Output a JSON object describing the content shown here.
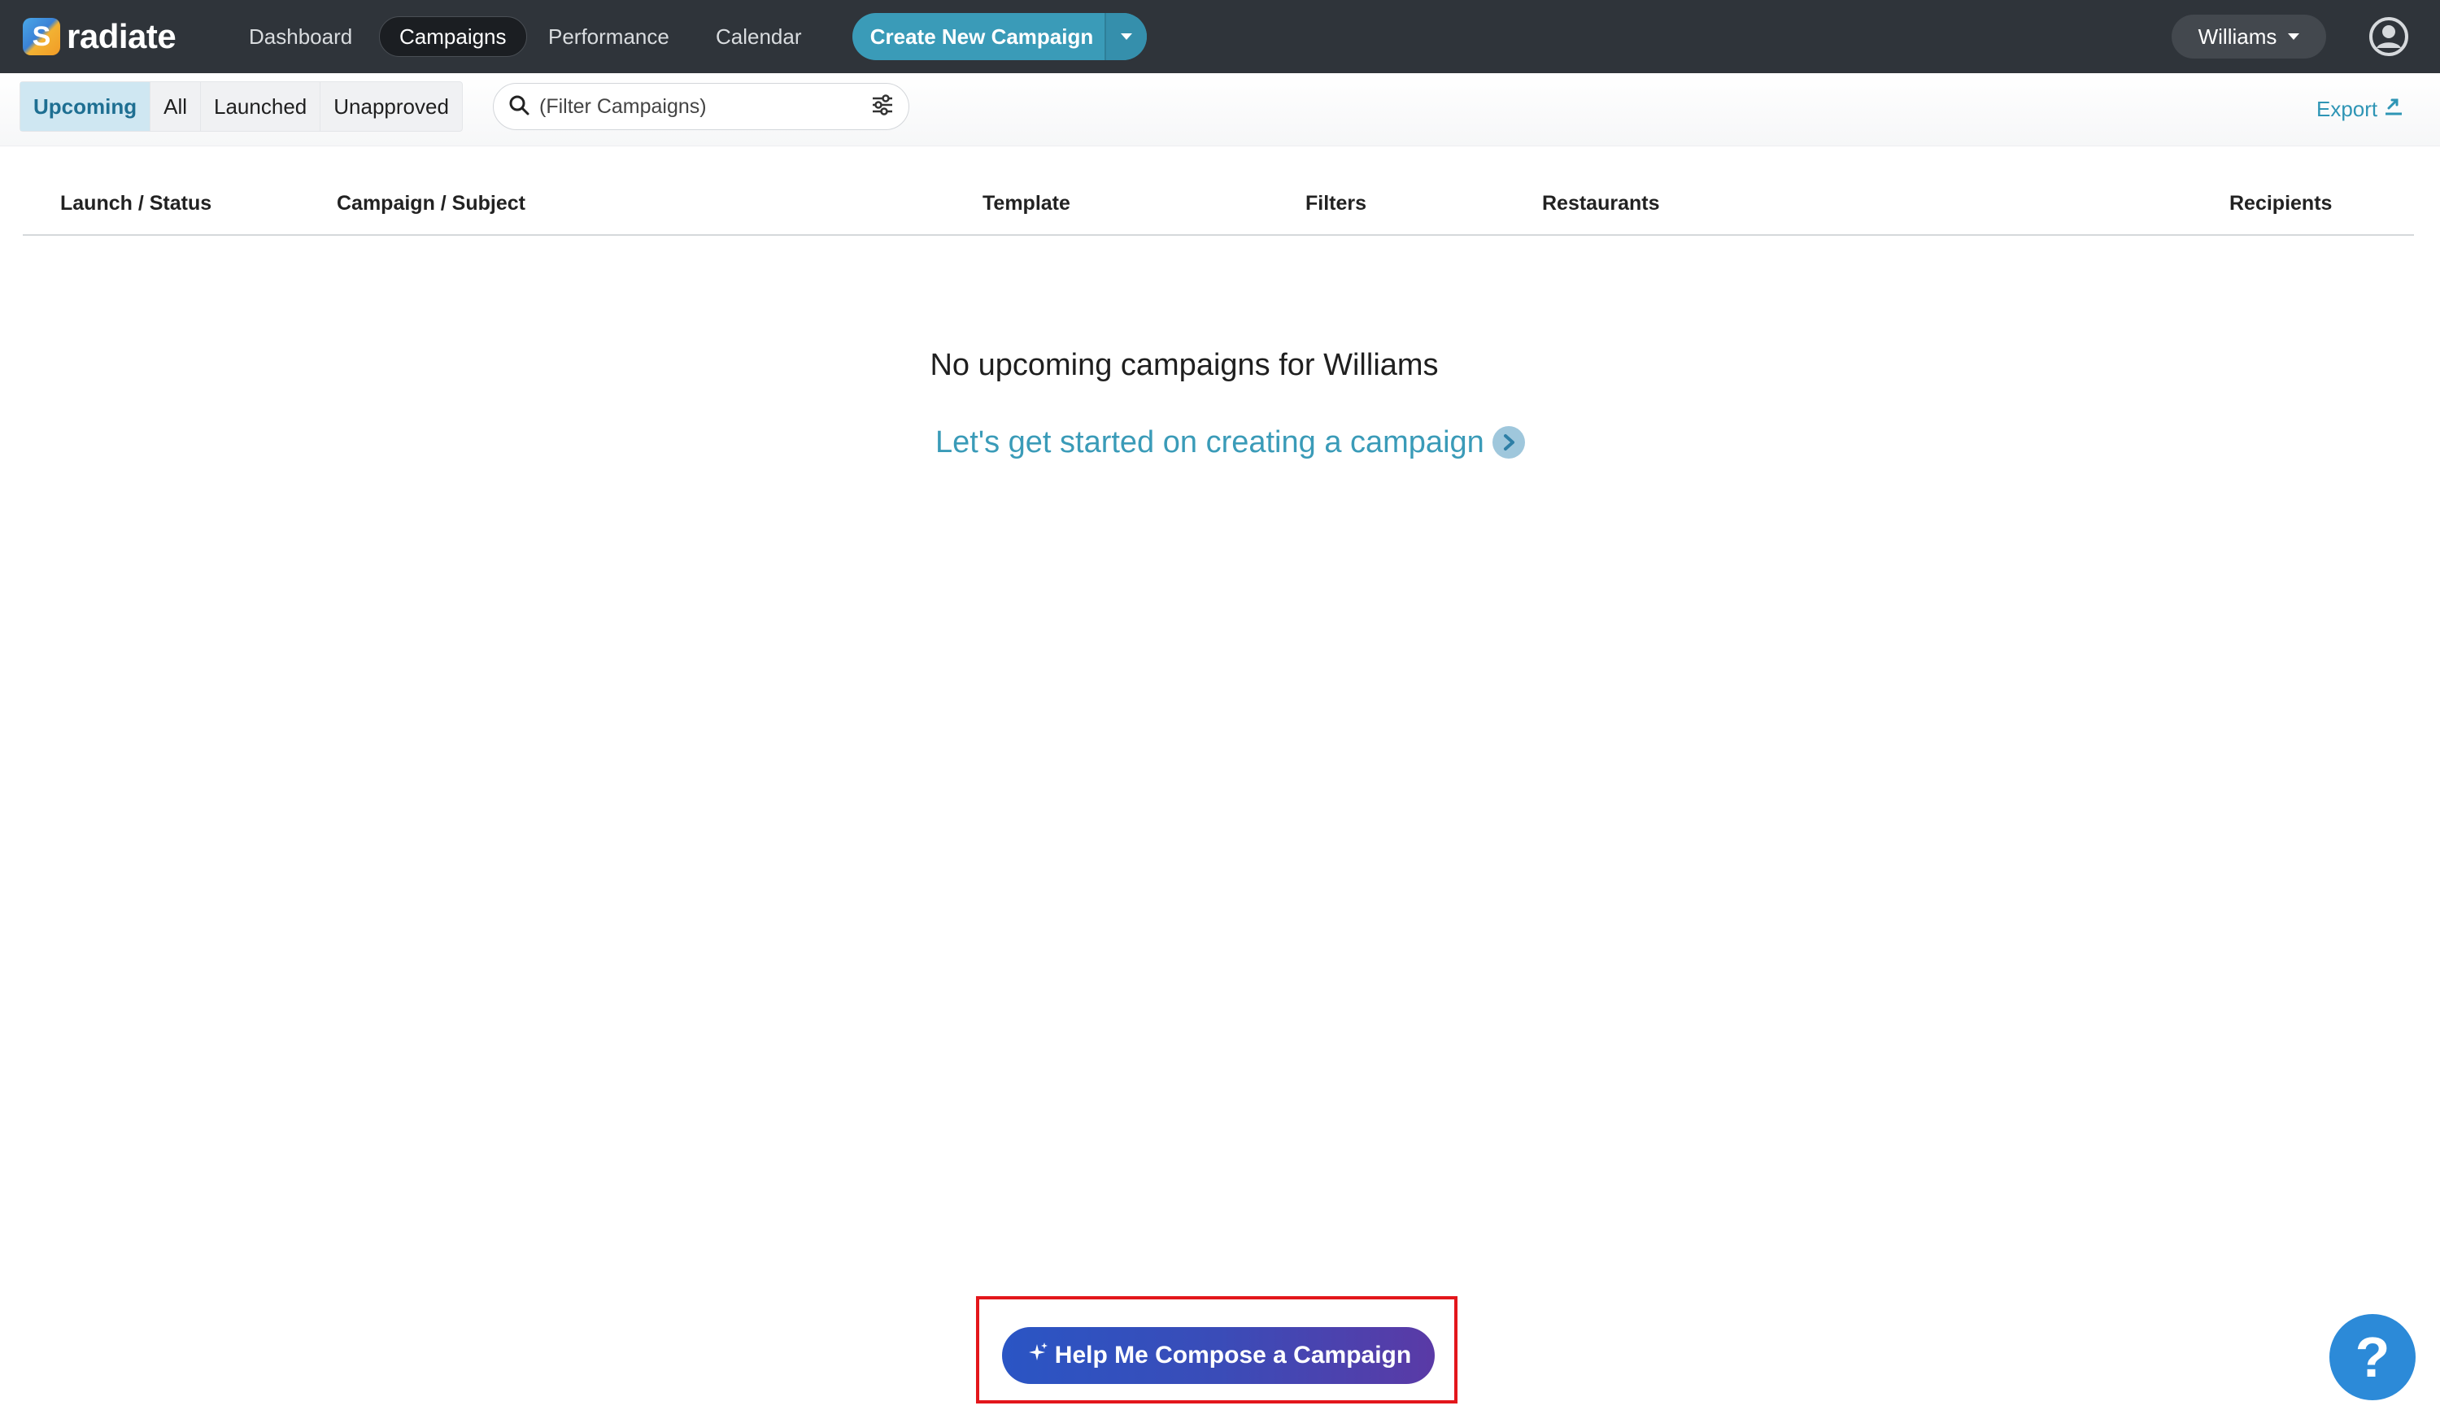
{
  "brand": {
    "name": "radiate"
  },
  "nav": {
    "items": [
      {
        "label": "Dashboard"
      },
      {
        "label": "Campaigns"
      },
      {
        "label": "Performance"
      },
      {
        "label": "Calendar"
      }
    ],
    "active": "Campaigns",
    "create_button_label": "Create New Campaign",
    "account_label": "Williams"
  },
  "toolbar": {
    "tabs": [
      {
        "label": "Upcoming"
      },
      {
        "label": "All"
      },
      {
        "label": "Launched"
      },
      {
        "label": "Unapproved"
      }
    ],
    "active_tab": "Upcoming",
    "search_placeholder": "(Filter Campaigns)",
    "export_label": "Export"
  },
  "table": {
    "columns": [
      "Launch / Status",
      "Campaign / Subject",
      "Template",
      "Filters",
      "Restaurants",
      "Recipients"
    ]
  },
  "empty_state": {
    "message": "No upcoming campaigns for Williams",
    "cta": "Let's get started on creating a campaign"
  },
  "compose": {
    "label": "Help Me Compose a Campaign"
  },
  "help": {
    "label": "?"
  },
  "colors": {
    "topbar": "#2f343a",
    "accent": "#3a9bb8",
    "compose_start": "#2a55c4",
    "compose_end": "#5a3aa6",
    "highlight": "#e3161b",
    "help": "#2c8ad8"
  },
  "icons": {
    "logo": "radiate-logo-icon",
    "dropdown": "caret-down-icon",
    "user": "user-avatar-icon",
    "search": "search-icon",
    "filter": "sliders-icon",
    "export": "export-icon",
    "cta": "chevron-right-circle-icon",
    "compose": "sparkle-icon",
    "help": "question-icon"
  }
}
